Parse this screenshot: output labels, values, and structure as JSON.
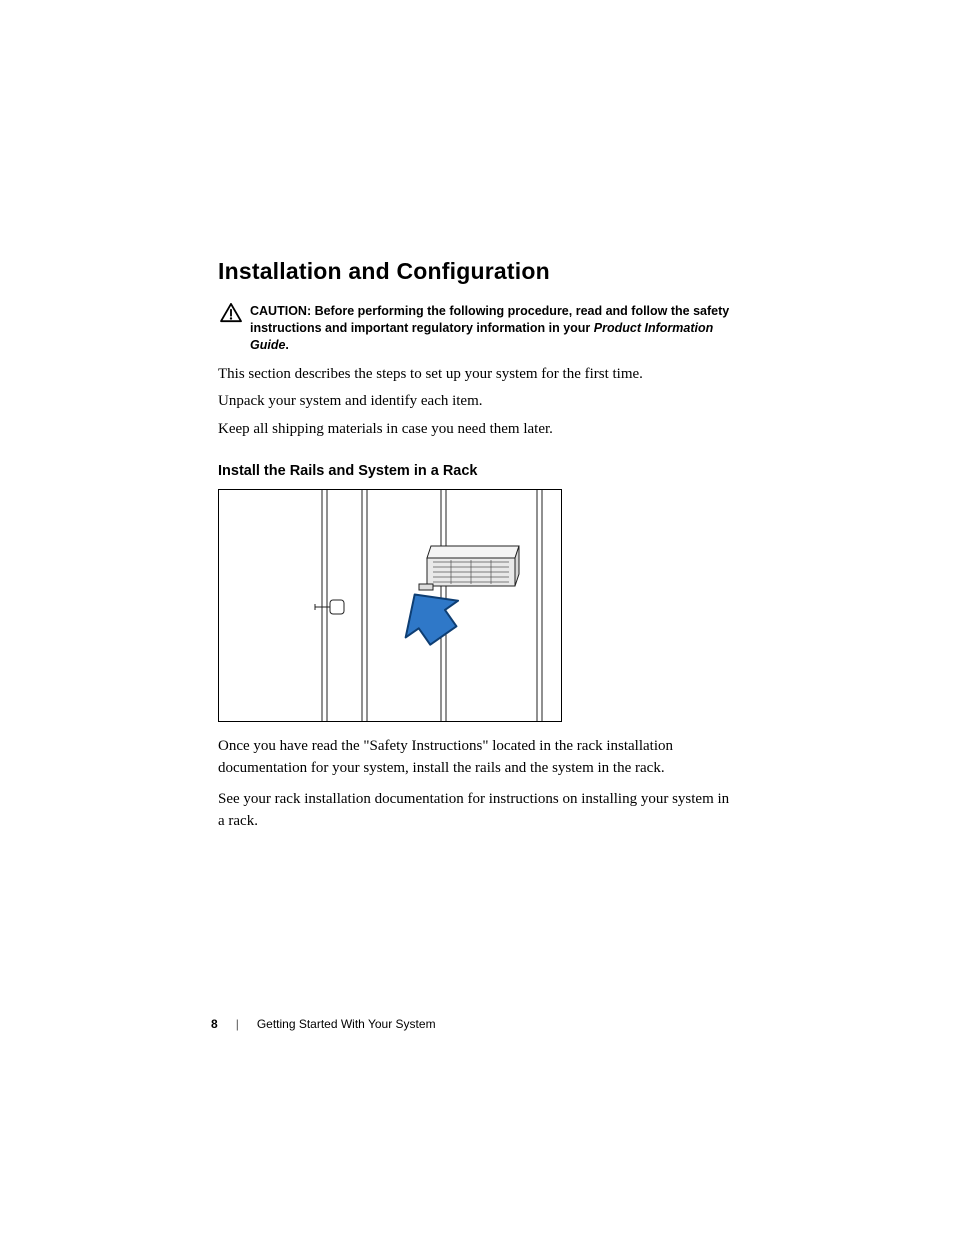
{
  "section": {
    "title": "Installation and Configuration",
    "caution_label": "CAUTION:",
    "caution_text_1": " Before performing the following procedure, read and follow the safety instructions and important regulatory information in your ",
    "caution_text_italic": "Product Information Guide",
    "caution_text_2": ".",
    "para1": "This section describes the steps to set up your system for the first time.",
    "para2": "Unpack your system and identify each item.",
    "para3": "Keep all shipping materials in case you need them later.",
    "subhead": "Install the Rails and System in a Rack",
    "para4": "Once you have read the \"Safety Instructions\" located in the rack installation documentation for your system, install the rails and the system in the rack.",
    "para5": "See your rack installation documentation for instructions on installing your system in a rack."
  },
  "footer": {
    "page_number": "8",
    "divider": "|",
    "section_name": "Getting Started With Your System"
  },
  "figure": {
    "alt": "rack-installation-diagram"
  }
}
